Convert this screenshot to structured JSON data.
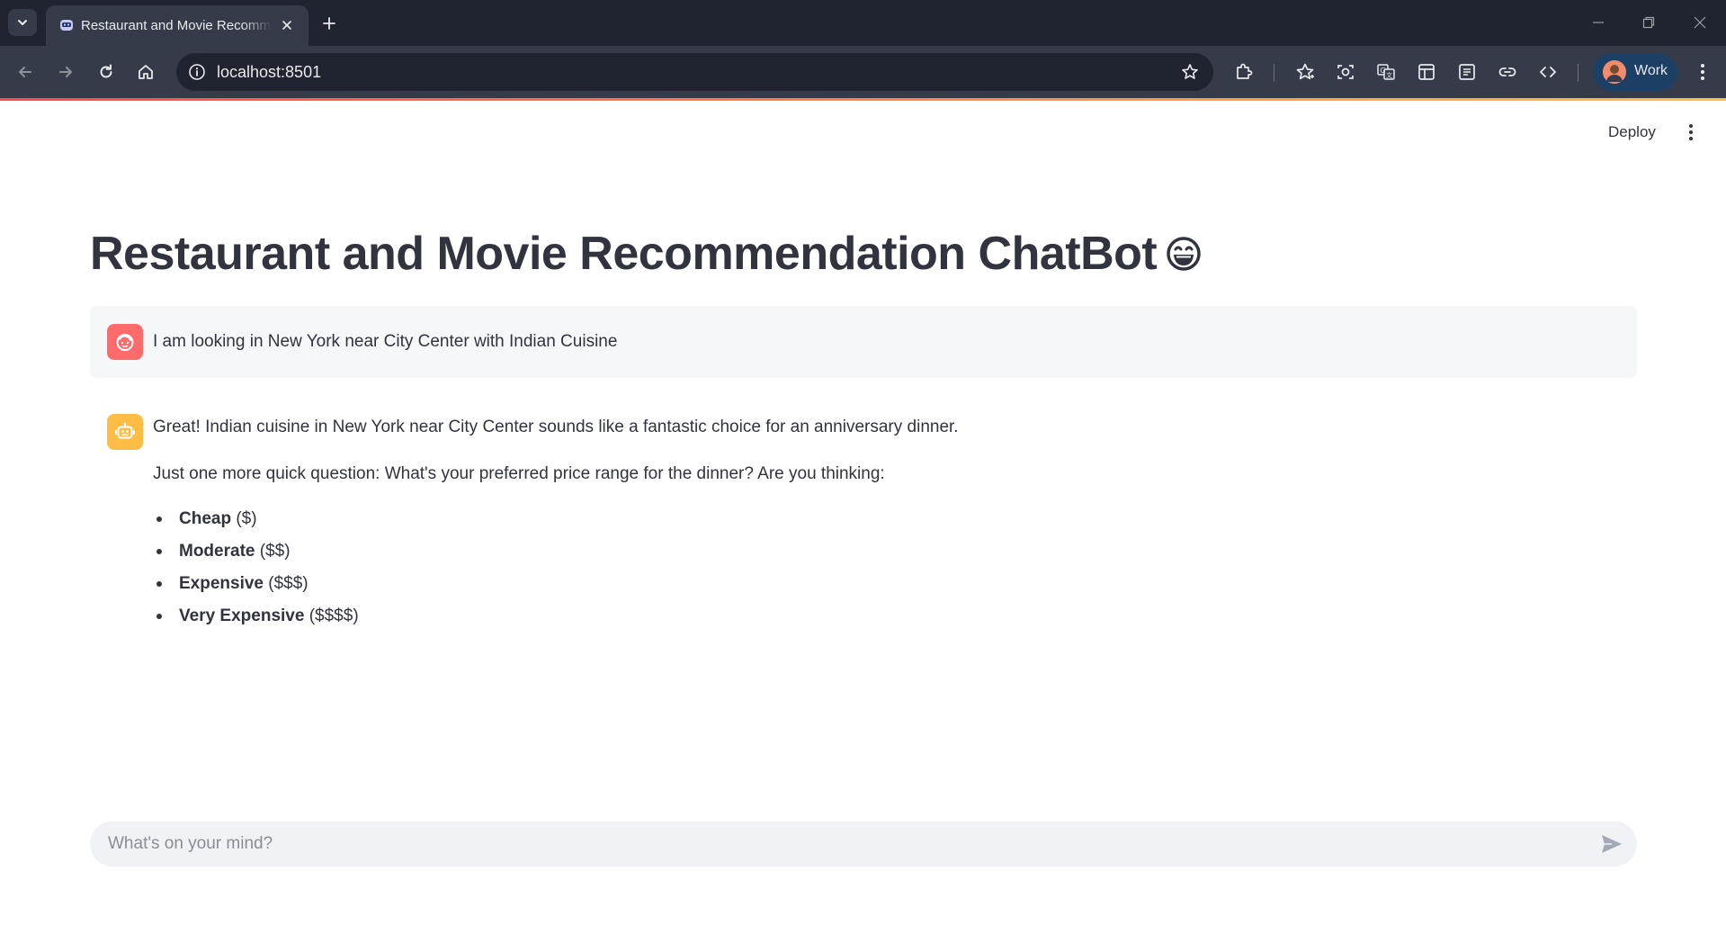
{
  "browser": {
    "tab_title": "Restaurant and Movie Recommendation ChatBot",
    "url": "localhost:8501",
    "profile_name": "Work",
    "icons": [
      "tab-search-icon",
      "favicon-robot-icon",
      "close-icon",
      "plus-icon",
      "minimize-icon",
      "restore-icon",
      "window-close-icon",
      "back-arrow-icon",
      "forward-arrow-icon",
      "reload-icon",
      "home-icon",
      "site-info-icon",
      "bookmark-star-icon",
      "extensions-icon",
      "bookmarks-icon",
      "screenshot-icon",
      "translate-icon",
      "tab-layout-icon",
      "reading-list-icon",
      "link-icon",
      "code-icon",
      "kebab-menu-icon"
    ]
  },
  "app": {
    "deploy_label": "Deploy",
    "title": "Restaurant and Movie Recommendation ChatBot",
    "title_emoji": "grinning-face-icon",
    "accent_colors": [
      "#ff4b4b",
      "#ffbd45"
    ]
  },
  "chat": {
    "messages": [
      {
        "role": "user",
        "avatar": "user-face-icon",
        "text": "I am looking in New York near City Center with Indian Cuisine"
      },
      {
        "role": "assistant",
        "avatar": "robot-icon",
        "paragraphs": [
          "Great! Indian cuisine in New York near City Center sounds like a fantastic choice for an anniversary dinner.",
          "Just one more quick question: What's your preferred price range for the dinner? Are you thinking:"
        ],
        "options": [
          {
            "label": "Cheap",
            "price": "($)"
          },
          {
            "label": "Moderate",
            "price": "($$)"
          },
          {
            "label": "Expensive",
            "price": "($$$)"
          },
          {
            "label": "Very Expensive",
            "price": "($$$$)"
          }
        ]
      }
    ],
    "input_placeholder": "What's on your mind?",
    "input_value": ""
  }
}
